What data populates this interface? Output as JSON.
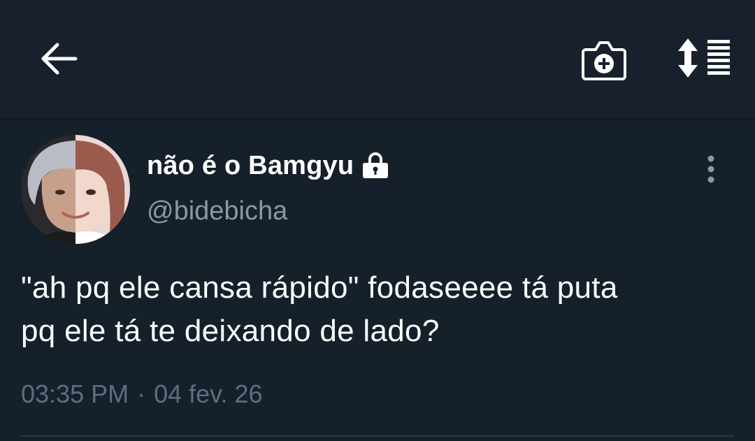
{
  "header": {
    "back_icon": "arrow-left-icon",
    "camera_icon": "camera-plus-icon",
    "sort_icon": "sort-list-icon"
  },
  "tweet": {
    "display_name": "não é o Bamgyu",
    "protected_icon": "lock-icon",
    "handle": "@bidebicha",
    "more_icon": "vertical-dots-icon",
    "text_line_1": "\"ah pq ele cansa rápido\" fodaseeee tá puta",
    "text_line_2": "pq ele tá te deixando de lado?",
    "time": "03:35 PM",
    "separator": "·",
    "date": "04 fev. 26"
  },
  "colors": {
    "background": "#15202b",
    "topbar": "#17202c",
    "text_primary": "#ffffff",
    "text_secondary": "#8899a6",
    "timestamp": "#5d6e7f",
    "divider": "#2b3947"
  }
}
